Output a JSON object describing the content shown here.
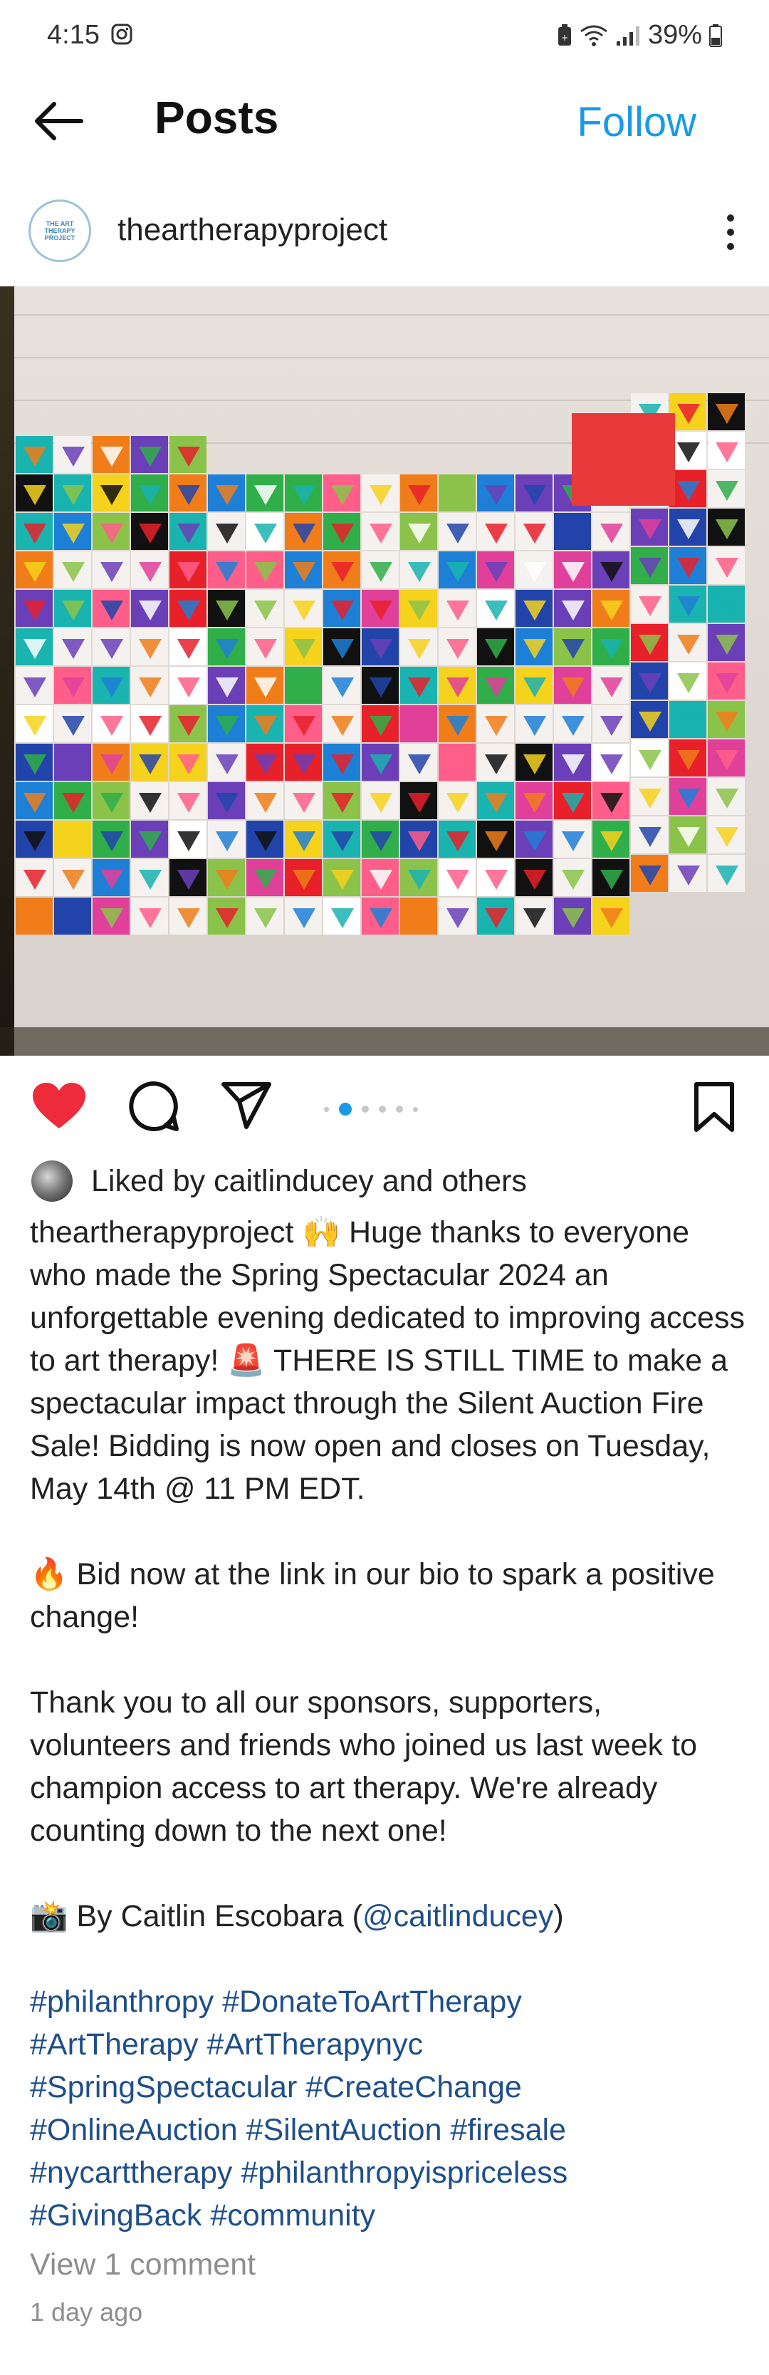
{
  "status_bar": {
    "time": "4:15",
    "battery": "39%",
    "icons": [
      "instagram-icon",
      "battery-saver-icon",
      "wifi-icon",
      "signal-icon",
      "battery-icon"
    ]
  },
  "header": {
    "title": "Posts",
    "follow_label": "Follow",
    "back_icon": "back-arrow-icon"
  },
  "post": {
    "username": "theartherapyproject",
    "avatar_text": "THE ART THERAPY PROJECT",
    "image": {
      "description": "mural-of-colorful-tiles",
      "carousel_total": 6,
      "carousel_active": 2
    },
    "likes_text": "Liked by caitlinducey and others",
    "caption": {
      "username": "theartherapyproject",
      "para1_emoji": "🙌",
      "para1_a": "Huge thanks to everyone who made the Spring Spectacular 2024 an unforgettable evening dedicated to improving access to art therapy!",
      "para1_emoji2": "🚨",
      "para1_b": "THERE IS STILL TIME to make a spectacular impact through the Silent Auction Fire Sale! Bidding is now open and closes on Tuesday, May 14th @ 11 PM EDT.",
      "para2_emoji": "🔥",
      "para2": "Bid now at the link in our bio to spark a positive change!",
      "para3": "Thank you to all our sponsors, supporters, volunteers and friends who joined us last week to champion access to art therapy. We're already counting down to the next one!",
      "para4_emoji": "📸",
      "para4_prefix": "By Caitlin Escobara (",
      "para4_mention": "@caitlinducey",
      "para4_suffix": ")",
      "hashtags": [
        "#philanthropy #DonateToArtTherapy",
        "#ArtTherapy #ArtTherapynyc",
        "#SpringSpectacular #CreateChange",
        "#OnlineAuction #SilentAuction #firesale",
        "#nycarttherapy #philanthropyispriceless",
        "#GivingBack #community"
      ]
    },
    "view_comments": "View 1 comment",
    "timestamp": "1 day ago"
  },
  "colors": {
    "accent": "#1a9ae6",
    "heart": "#ed2b3b",
    "hashtag": "#1f4f8a",
    "muted": "#8e8e8e"
  }
}
